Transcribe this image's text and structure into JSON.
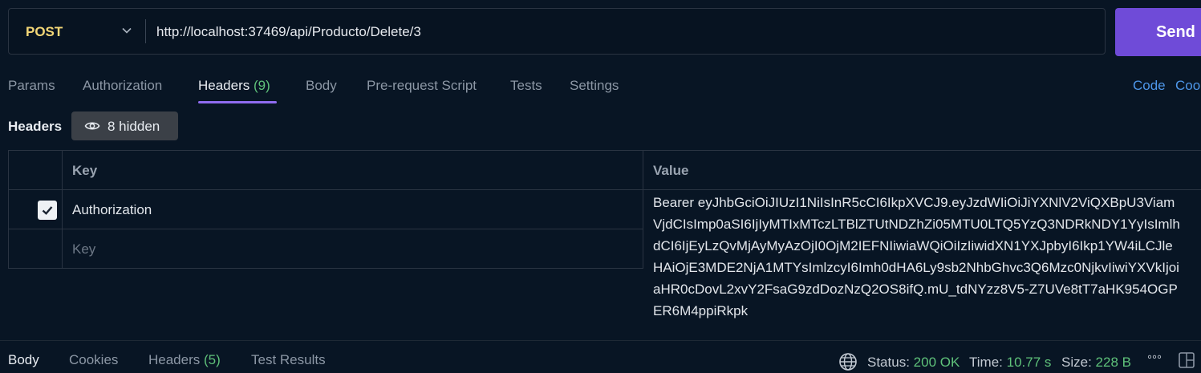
{
  "request": {
    "method": "POST",
    "url": "http://localhost:37469/api/Producto/Delete/3",
    "send_label": "Send"
  },
  "tabs": [
    {
      "label": "Params"
    },
    {
      "label": "Authorization"
    },
    {
      "label": "Headers",
      "count": "(9)"
    },
    {
      "label": "Body"
    },
    {
      "label": "Pre-request Script"
    },
    {
      "label": "Tests"
    },
    {
      "label": "Settings"
    }
  ],
  "links": {
    "code": "Code",
    "cookies": "Coo"
  },
  "headers_section": {
    "title": "Headers",
    "hidden_label": "8 hidden",
    "columns": {
      "key": "Key",
      "value": "Value"
    },
    "rows": [
      {
        "key": "Authorization",
        "value": "Bearer eyJhbGciOiJIUzI1NiIsInR5cCI6IkpXVCJ9.eyJzdWIiOiJiYXNlV2ViQXBpU3ViamVjdCIsImp0aSI6IjIyMTIxMTczLTBlZTUtNDZhZi05MTU0LTQ5YzQ3NDRkNDY1YyIsImlhdCI6IjEyLzQvMjAyMyAzOjI0OjM2IEFNIiwiaWQiOiIzIiwidXN1YXJpbyI6Ikp1YW4iLCJleHAiOjE3MDE2NjA1MTYsImlzcyI6Imh0dHA6Ly9sb2NhbGhvc3Q6Mzc0NjkvIiwiYXVkIjoiaHR0cDovL2xvY2FsaG9zdDozNzQ2OS8ifQ.mU_tdNYzz8V5-Z7UVe8tT7aHK954OGPER6M4ppiRkpk",
        "checked": true
      }
    ],
    "new_key_placeholder": "Key"
  },
  "response": {
    "tabs": [
      {
        "label": "Body"
      },
      {
        "label": "Cookies"
      },
      {
        "label": "Headers",
        "count": "(5)"
      },
      {
        "label": "Test Results"
      }
    ],
    "status_label": "Status:",
    "status_value": "200 OK",
    "time_label": "Time:",
    "time_value": "10.77 s",
    "size_label": "Size:",
    "size_value": "228 B",
    "more": "°°°"
  },
  "colors": {
    "accent": "#6f4bd8",
    "method": "#f3d777",
    "success": "#5fc27a",
    "link": "#4e97ea"
  },
  "icons": [
    "chevron-down-icon",
    "eye-icon",
    "check-icon",
    "globe-icon",
    "more-icon",
    "layout-icon"
  ]
}
